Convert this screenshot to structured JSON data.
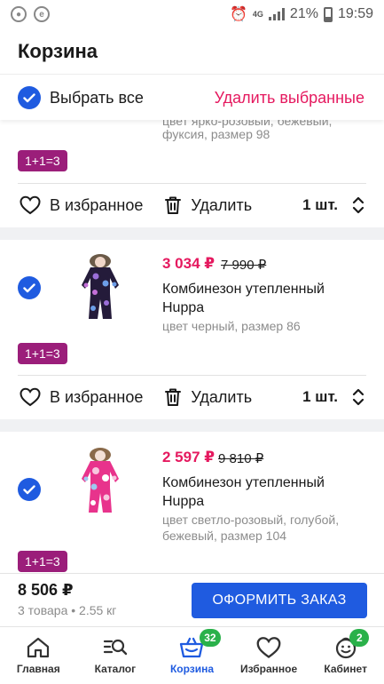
{
  "status_bar": {
    "battery": "21%",
    "time": "19:59",
    "network": "4G"
  },
  "header": {
    "title": "Корзина"
  },
  "select_all": {
    "label": "Выбрать все",
    "delete_label": "Удалить выбранные"
  },
  "items": [
    {
      "spec_line1": "цвет ярко-розовый, бежевый,",
      "spec_line2": "фуксия, размер 98",
      "promo": "1+1=3",
      "favorite_label": "В избранное",
      "delete_label": "Удалить",
      "qty": "1 шт."
    },
    {
      "price": "3 034 ₽",
      "old_price": "7 990 ₽",
      "title": "Комбинезон утепленный Huppa",
      "spec_line1": "цвет черный, размер 86",
      "promo": "1+1=3",
      "favorite_label": "В избранное",
      "delete_label": "Удалить",
      "qty": "1 шт."
    },
    {
      "price": "2 597 ₽",
      "old_price": "9 810 ₽",
      "title": "Комбинезон утепленный Huppa",
      "spec_line1": "цвет светло-розовый, голубой,",
      "spec_line2": "бежевый, размер 104",
      "promo": "1+1=3"
    }
  ],
  "footer": {
    "total": "8 506 ₽",
    "meta": "3 товара • 2.55 кг",
    "checkout_label": "ОФОРМИТЬ ЗАКАЗ"
  },
  "tabbar": {
    "tabs": [
      {
        "label": "Главная",
        "icon": "home-icon"
      },
      {
        "label": "Каталог",
        "icon": "catalog-search-icon"
      },
      {
        "label": "Корзина",
        "icon": "basket-icon",
        "badge": "32",
        "active": true
      },
      {
        "label": "Избранное",
        "icon": "heart-icon"
      },
      {
        "label": "Кабинет",
        "icon": "smiley-icon",
        "badge": "2"
      }
    ]
  },
  "colors": {
    "accent": "#1f5be0",
    "price": "#e5195f",
    "promo": "#9b1e7a",
    "badge": "#2ab14a"
  }
}
